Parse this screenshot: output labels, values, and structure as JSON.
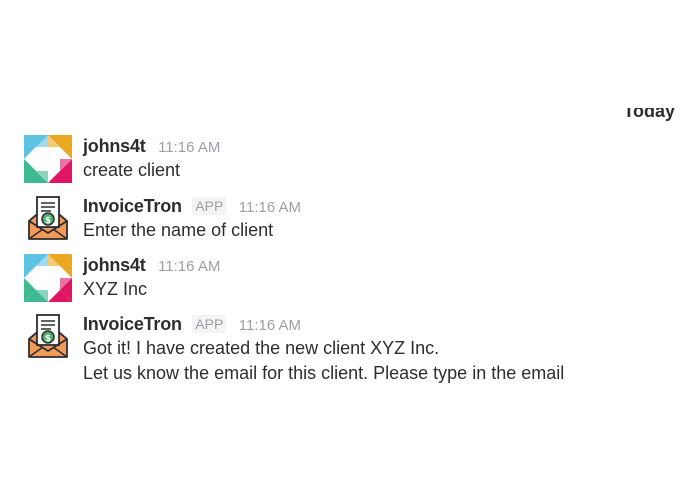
{
  "day_divider": "Today",
  "messages": [
    {
      "sender": "johns4t",
      "is_app": false,
      "app_badge": "",
      "time": "11:16 AM",
      "lines": [
        "create client"
      ],
      "avatar": "slack-logo-avatar"
    },
    {
      "sender": "InvoiceTron",
      "is_app": true,
      "app_badge": "APP",
      "time": "11:16 AM",
      "lines": [
        "Enter the name of client"
      ],
      "avatar": "invoice-envelope-avatar"
    },
    {
      "sender": "johns4t",
      "is_app": false,
      "app_badge": "",
      "time": "11:16 AM",
      "lines": [
        "XYZ Inc"
      ],
      "avatar": "slack-logo-avatar"
    },
    {
      "sender": "InvoiceTron",
      "is_app": true,
      "app_badge": "APP",
      "time": "11:16 AM",
      "lines": [
        "Got it! I have created the new client XYZ Inc.",
        "Let us know the email for this client. Please type in the email"
      ],
      "avatar": "invoice-envelope-avatar"
    }
  ],
  "colors": {
    "text": "#2c2d30",
    "muted": "#9e9ea6",
    "badge_bg": "#f4f4f4",
    "slack_blue": "#5ec2e3",
    "slack_yellow": "#e9a820",
    "slack_green": "#3eb991",
    "slack_pink": "#e01563",
    "envelope_orange": "#f29a5a",
    "money_green": "#4fb06d"
  }
}
